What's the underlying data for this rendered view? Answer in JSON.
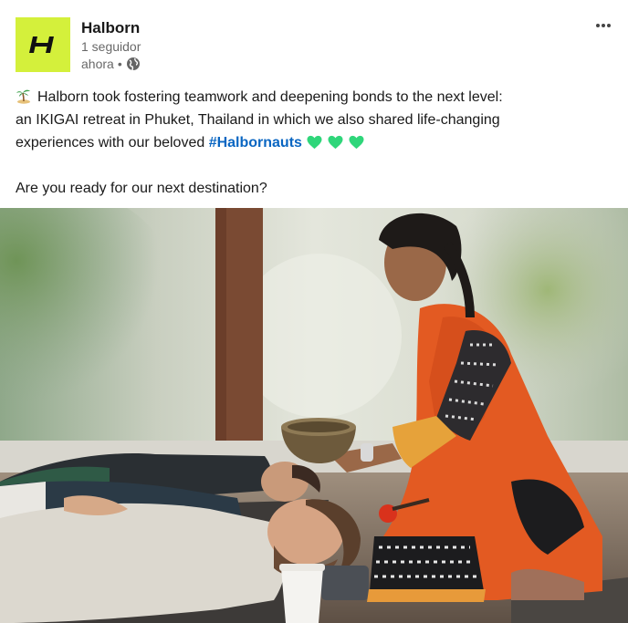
{
  "author": {
    "name": "Halborn",
    "followers": "1 seguidor",
    "time": "ahora",
    "time_separator": "•",
    "logo_color": "#d4f03b",
    "logo_icon": "halborn-h-logo",
    "visibility_icon": "globe-icon"
  },
  "menu": {
    "icon": "more-horizontal-icon"
  },
  "post": {
    "line1": "Halborn took fostering teamwork and deepening bonds to the next level:",
    "line2": "an IKIGAI retreat in Phuket, Thailand in which we also shared life-changing",
    "line3_prefix": "experiences with our beloved ",
    "hashtag": "#Halbornauts",
    "line5": "Are you ready for our next destination?",
    "leading_emoji": "palm-island-icon",
    "trailing_emoji": [
      "green-heart-icon",
      "green-heart-icon",
      "green-heart-icon"
    ],
    "hashtag_color": "#0a66c2",
    "heart_color": "#2fd67a"
  },
  "image": {
    "subject": "sound-bowl-meditation-photo"
  }
}
